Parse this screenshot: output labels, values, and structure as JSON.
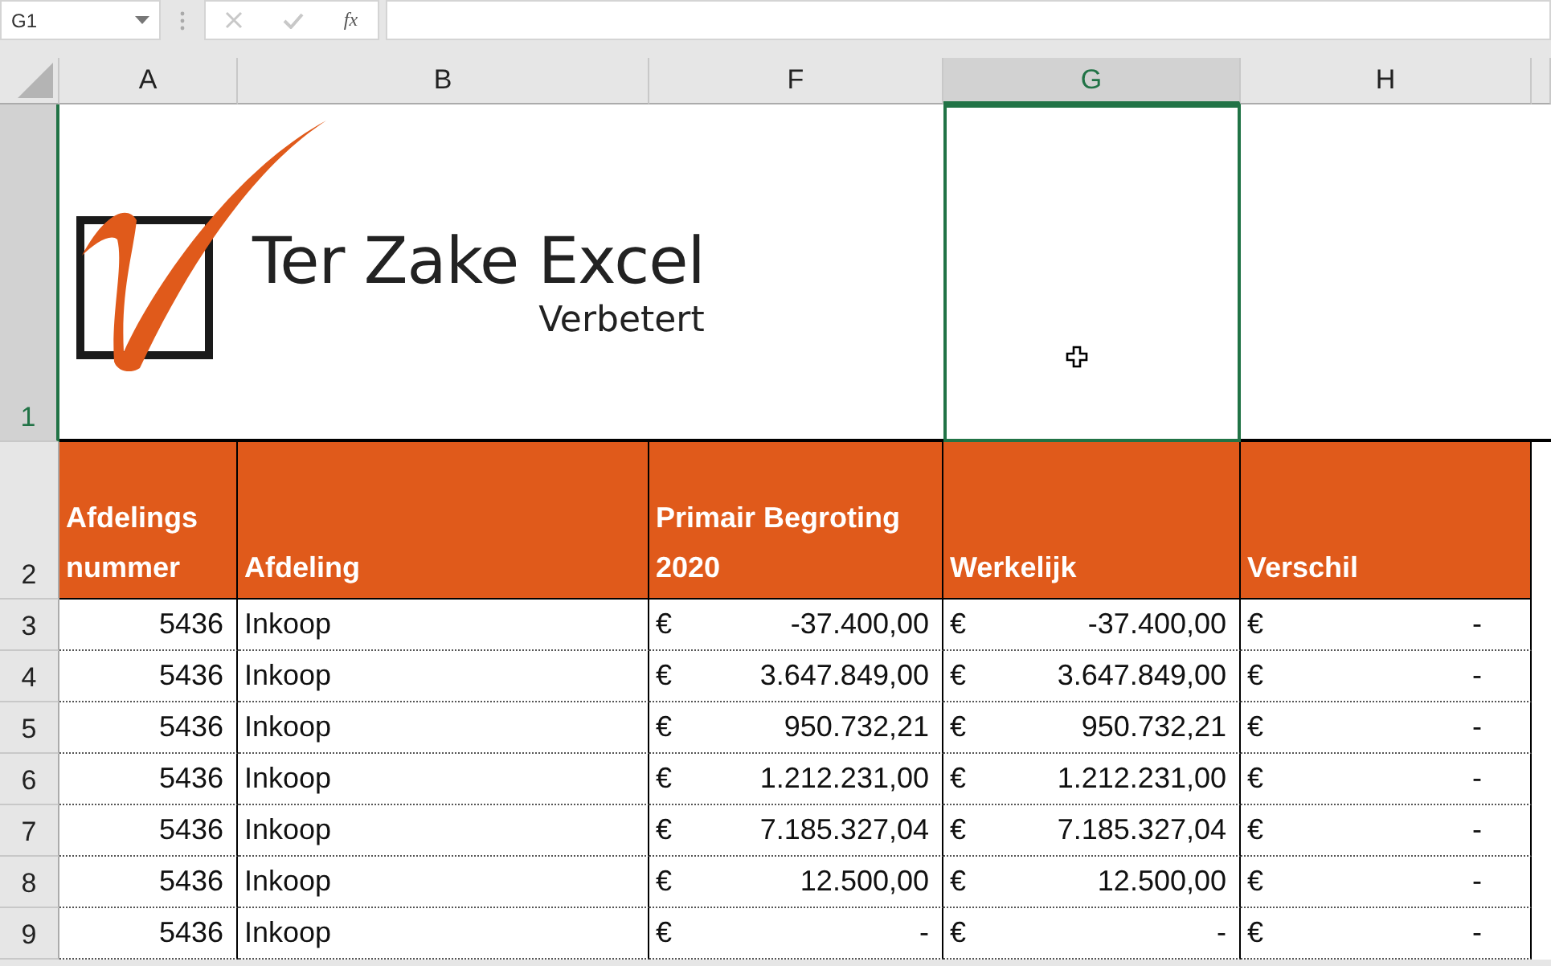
{
  "formula_bar": {
    "name_box": "G1",
    "function_label": "fx"
  },
  "columns": [
    {
      "label": "A",
      "selected": false
    },
    {
      "label": "B",
      "selected": false
    },
    {
      "label": "F",
      "selected": false
    },
    {
      "label": "G",
      "selected": true
    },
    {
      "label": "H",
      "selected": false
    }
  ],
  "logo": {
    "title": "Ter Zake Excel",
    "subtitle": "Verbetert"
  },
  "logo_row": {
    "number": "1",
    "selected": true,
    "cells": [
      {
        "active": true
      },
      {
        "active": false
      }
    ]
  },
  "header_row": {
    "number": "2",
    "cells": [
      "Afdelings nummer",
      "Afdeling",
      "Primair Begroting 2020",
      "Werkelijk",
      "Verschil"
    ]
  },
  "rows": [
    {
      "number": "3",
      "cells": [
        {
          "kind": "number",
          "text": "5436"
        },
        {
          "kind": "text",
          "text": "Inkoop"
        },
        {
          "kind": "currency",
          "symbol": "€",
          "amount": "-37.400,00"
        },
        {
          "kind": "currency",
          "symbol": "€",
          "amount": "-37.400,00"
        },
        {
          "kind": "currency",
          "symbol": "€",
          "amount": "-"
        }
      ]
    },
    {
      "number": "4",
      "cells": [
        {
          "kind": "number",
          "text": "5436"
        },
        {
          "kind": "text",
          "text": "Inkoop"
        },
        {
          "kind": "currency",
          "symbol": "€",
          "amount": "3.647.849,00"
        },
        {
          "kind": "currency",
          "symbol": "€",
          "amount": "3.647.849,00"
        },
        {
          "kind": "currency",
          "symbol": "€",
          "amount": "-"
        }
      ]
    },
    {
      "number": "5",
      "cells": [
        {
          "kind": "number",
          "text": "5436"
        },
        {
          "kind": "text",
          "text": "Inkoop"
        },
        {
          "kind": "currency",
          "symbol": "€",
          "amount": "950.732,21"
        },
        {
          "kind": "currency",
          "symbol": "€",
          "amount": "950.732,21"
        },
        {
          "kind": "currency",
          "symbol": "€",
          "amount": "-"
        }
      ]
    },
    {
      "number": "6",
      "cells": [
        {
          "kind": "number",
          "text": "5436"
        },
        {
          "kind": "text",
          "text": "Inkoop"
        },
        {
          "kind": "currency",
          "symbol": "€",
          "amount": "1.212.231,00"
        },
        {
          "kind": "currency",
          "symbol": "€",
          "amount": "1.212.231,00"
        },
        {
          "kind": "currency",
          "symbol": "€",
          "amount": "-"
        }
      ]
    },
    {
      "number": "7",
      "cells": [
        {
          "kind": "number",
          "text": "5436"
        },
        {
          "kind": "text",
          "text": "Inkoop"
        },
        {
          "kind": "currency",
          "symbol": "€",
          "amount": "7.185.327,04"
        },
        {
          "kind": "currency",
          "symbol": "€",
          "amount": "7.185.327,04"
        },
        {
          "kind": "currency",
          "symbol": "€",
          "amount": "-"
        }
      ]
    },
    {
      "number": "8",
      "cells": [
        {
          "kind": "number",
          "text": "5436"
        },
        {
          "kind": "text",
          "text": "Inkoop"
        },
        {
          "kind": "currency",
          "symbol": "€",
          "amount": "12.500,00"
        },
        {
          "kind": "currency",
          "symbol": "€",
          "amount": "12.500,00"
        },
        {
          "kind": "currency",
          "symbol": "€",
          "amount": "-"
        }
      ]
    },
    {
      "number": "9",
      "cells": [
        {
          "kind": "number",
          "text": "5436"
        },
        {
          "kind": "text",
          "text": "Inkoop"
        },
        {
          "kind": "currency",
          "symbol": "€",
          "amount": "-"
        },
        {
          "kind": "currency",
          "symbol": "€",
          "amount": "-"
        },
        {
          "kind": "currency",
          "symbol": "€",
          "amount": "-"
        }
      ]
    }
  ]
}
